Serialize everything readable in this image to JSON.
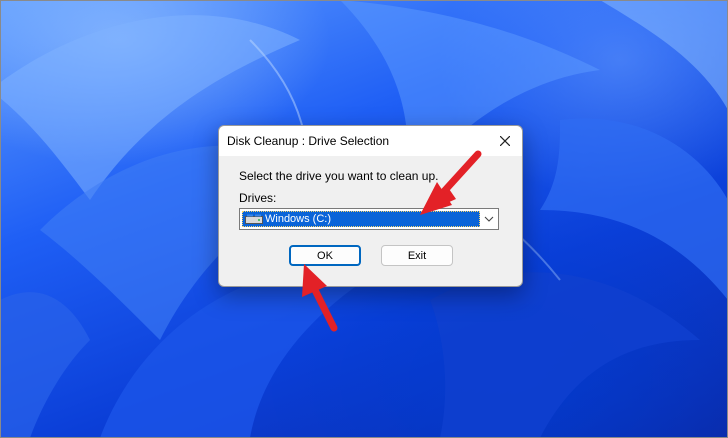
{
  "dialog": {
    "title": "Disk Cleanup : Drive Selection",
    "close_icon": "close-icon",
    "prompt": "Select the drive you want to clean up.",
    "drives_label": "Drives:",
    "drives_select": {
      "selected": "Windows (C:)",
      "icon": "drive-icon"
    },
    "buttons": {
      "ok": "OK",
      "exit": "Exit"
    }
  },
  "annotations": {
    "arrow_color": "#e32127"
  },
  "colors": {
    "selection": "#0a64d8",
    "ok_focus": "#0067c0"
  }
}
